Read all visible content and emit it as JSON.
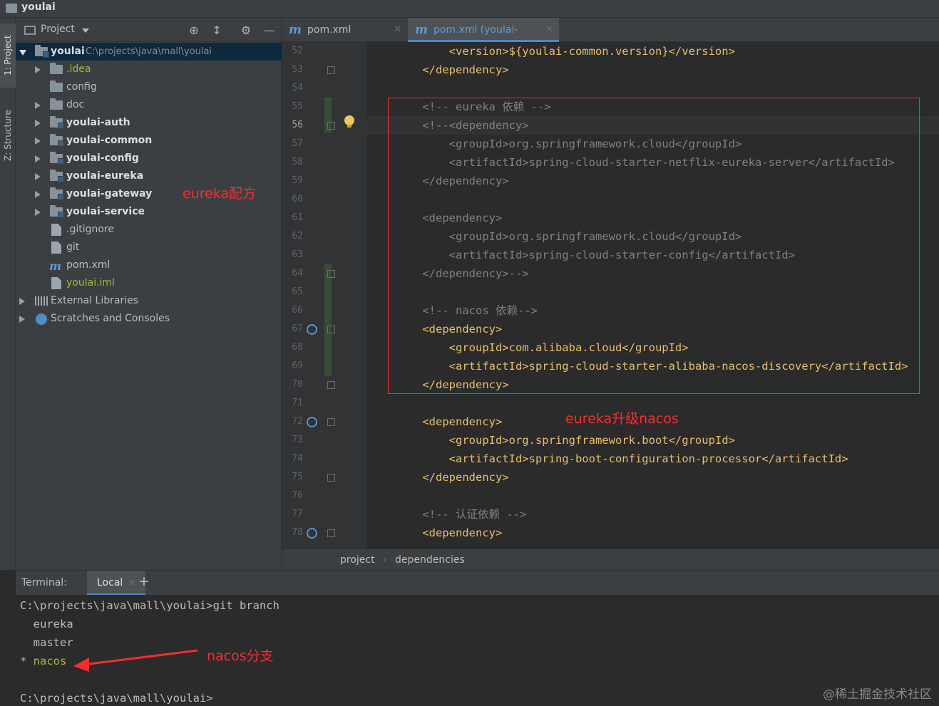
{
  "window": {
    "title": "youlai"
  },
  "sidebar_tabs": {
    "project": "1: Project",
    "structure": "Z: Structure"
  },
  "project_panel": {
    "header": "Project",
    "tree": [
      {
        "label": "youlai",
        "path": "C:\\projects\\java\\mall\\youlai",
        "type": "root"
      },
      {
        "label": ".idea",
        "type": "folder"
      },
      {
        "label": "config",
        "type": "folder"
      },
      {
        "label": "doc",
        "type": "folder"
      },
      {
        "label": "youlai-auth",
        "type": "module"
      },
      {
        "label": "youlai-common",
        "type": "module"
      },
      {
        "label": "youlai-config",
        "type": "module"
      },
      {
        "label": "youlai-eureka",
        "type": "module"
      },
      {
        "label": "youlai-gateway",
        "type": "module"
      },
      {
        "label": "youlai-service",
        "type": "module"
      },
      {
        "label": ".gitignore",
        "type": "file"
      },
      {
        "label": "git",
        "type": "file"
      },
      {
        "label": "pom.xml",
        "type": "maven"
      },
      {
        "label": "youlai.iml",
        "type": "file"
      },
      {
        "label": "External Libraries",
        "type": "libraries"
      },
      {
        "label": "Scratches and Consoles",
        "type": "scratches"
      }
    ]
  },
  "annotations": {
    "eureka_recipe": "eureka配方",
    "upgrade": "eureka升级nacos",
    "nacos_branch": "nacos分支"
  },
  "editor": {
    "tabs": [
      {
        "label": "pom.xml (youlai)",
        "active": false
      },
      {
        "label": "pom.xml (youlai-auth)",
        "active": true
      }
    ],
    "current_line": 56,
    "lines": [
      {
        "n": "52",
        "text": "        <version>${youlai-common.version}</version>",
        "style": "tag"
      },
      {
        "n": "53",
        "text": "    </dependency>",
        "style": "tag"
      },
      {
        "n": "54",
        "text": "",
        "style": "tag"
      },
      {
        "n": "55",
        "text": "    <!-- eureka 依赖 -->",
        "style": "comment"
      },
      {
        "n": "56",
        "text": "    <!--<dependency>",
        "style": "comment"
      },
      {
        "n": "57",
        "text": "        <groupId>org.springframework.cloud</groupId>",
        "style": "comment"
      },
      {
        "n": "58",
        "text": "        <artifactId>spring-cloud-starter-netflix-eureka-server</artifactId>",
        "style": "comment"
      },
      {
        "n": "59",
        "text": "    </dependency>",
        "style": "comment"
      },
      {
        "n": "60",
        "text": "",
        "style": "comment"
      },
      {
        "n": "61",
        "text": "    <dependency>",
        "style": "comment"
      },
      {
        "n": "62",
        "text": "        <groupId>org.springframework.cloud</groupId>",
        "style": "comment"
      },
      {
        "n": "63",
        "text": "        <artifactId>spring-cloud-starter-config</artifactId>",
        "style": "comment"
      },
      {
        "n": "64",
        "text": "    </dependency>-->",
        "style": "comment"
      },
      {
        "n": "65",
        "text": "",
        "style": "comment"
      },
      {
        "n": "66",
        "text": "    <!-- nacos 依赖-->",
        "style": "comment"
      },
      {
        "n": "67",
        "text": "    <dependency>",
        "style": "tag"
      },
      {
        "n": "68",
        "text": "        <groupId>com.alibaba.cloud</groupId>",
        "style": "tag"
      },
      {
        "n": "69",
        "text": "        <artifactId>spring-cloud-starter-alibaba-nacos-discovery</artifactId>",
        "style": "tag"
      },
      {
        "n": "70",
        "text": "    </dependency>",
        "style": "tag"
      },
      {
        "n": "71",
        "text": "",
        "style": "tag"
      },
      {
        "n": "72",
        "text": "    <dependency>",
        "style": "tag"
      },
      {
        "n": "73",
        "text": "        <groupId>org.springframework.boot</groupId>",
        "style": "tag"
      },
      {
        "n": "74",
        "text": "        <artifactId>spring-boot-configuration-processor</artifactId>",
        "style": "tag"
      },
      {
        "n": "75",
        "text": "    </dependency>",
        "style": "tag"
      },
      {
        "n": "76",
        "text": "",
        "style": "tag"
      },
      {
        "n": "77",
        "text": "    <!-- 认证依赖 -->",
        "style": "comment"
      },
      {
        "n": "78",
        "text": "    <dependency>",
        "style": "tag"
      }
    ],
    "breadcrumb": [
      "project",
      "dependencies"
    ]
  },
  "terminal": {
    "label": "Terminal:",
    "tab": "Local",
    "add": "+",
    "lines": [
      {
        "text": "C:\\projects\\java\\mall\\youlai>git branch",
        "style": "normal"
      },
      {
        "text": "  eureka",
        "style": "normal"
      },
      {
        "text": "  master",
        "style": "normal"
      },
      {
        "text": "* nacos",
        "style": "current"
      },
      {
        "text": "",
        "style": "normal"
      },
      {
        "text": "C:\\projects\\java\\mall\\youlai>",
        "style": "normal"
      }
    ]
  },
  "watermark": "@稀土掘金技术社区",
  "colors": {
    "annotation": "#ff2b2b",
    "tag": "#e8bf6a",
    "comment": "#808080",
    "accent": "#4a88c7",
    "branch_current": "#a7b73c"
  }
}
